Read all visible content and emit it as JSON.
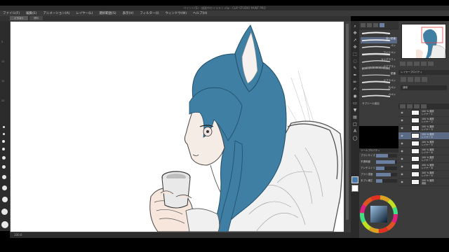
{
  "window": {
    "title": "ペイント(S) - 描画中のイラスト.clip - CLIP STUDIO PAINT PRO"
  },
  "menu": [
    "ファイル(F)",
    "編集(E)",
    "アニメーション(A)",
    "レイヤー(L)",
    "選択範囲(S)",
    "表示(V)",
    "フィルター(I)",
    "ウィンドウ(W)",
    "ヘルプ(H)"
  ],
  "tabs": [
    "イラスト",
    "資料"
  ],
  "status": {
    "zoom": "100.0"
  },
  "ruler": [
    "5",
    "10",
    "15",
    "20"
  ],
  "subtools": [
    {
      "label": "",
      "icon": "brush-stroke-icon"
    },
    {
      "label": "濃い鉛筆",
      "icon": "brush-stroke-icon"
    },
    {
      "label": "ペン",
      "icon": "brush-stroke-icon"
    },
    {
      "label": "ワイドペン",
      "icon": "brush-stroke-icon"
    },
    {
      "label": "カリグラフィ",
      "icon": "brush-stroke-icon"
    },
    {
      "label": "エアブラシ",
      "icon": "brush-stroke-icon"
    },
    {
      "label": "鉛筆",
      "icon": "brush-stroke-icon"
    },
    {
      "label": "カブラペン",
      "icon": "brush-stroke-icon"
    },
    {
      "label": "丸ペン",
      "icon": "brush-stroke-icon"
    },
    {
      "label": "Gペン",
      "icon": "brush-stroke-icon"
    }
  ],
  "subtool_footer": "サブツール追加",
  "tool_property": {
    "header": "ツールプロパティ",
    "rows": [
      {
        "label": "ブラシサイズ",
        "fill": 0.55
      },
      {
        "label": "不透明度",
        "fill": 0.9
      },
      {
        "label": "アンチエイリアス",
        "fill": 0.4
      },
      {
        "label": "ブラシ濃度",
        "fill": 0.7
      },
      {
        "label": "手ブレ補正",
        "fill": 0.3
      }
    ]
  },
  "layer_property": {
    "header": "レイヤープロパティ",
    "blend": "通常"
  },
  "layers": [
    {
      "name": "100 % 通常\nレイヤー 1",
      "active": false
    },
    {
      "name": "100 % 通常\nレイヤー 2",
      "active": false
    },
    {
      "name": "100 % 通常\nレイヤー 3",
      "active": false
    },
    {
      "name": "100 % 通常\nレイヤー 4",
      "active": true
    },
    {
      "name": "100 % 通常\nレイヤー 5",
      "active": false
    },
    {
      "name": "100 % 通常\nレイヤー 6",
      "active": false
    },
    {
      "name": "100 % 通常\nレイヤー 7",
      "active": false
    },
    {
      "name": "100 % 通常\nレイヤー 8",
      "active": false
    },
    {
      "name": "100 % 通常\nレイヤー 9",
      "active": false
    },
    {
      "name": "100 % 通常\n用紙",
      "active": false
    }
  ],
  "colors": {
    "hair": "#3f7fa3",
    "skin": "#f3e2d6",
    "accent": "#5b6b86"
  }
}
